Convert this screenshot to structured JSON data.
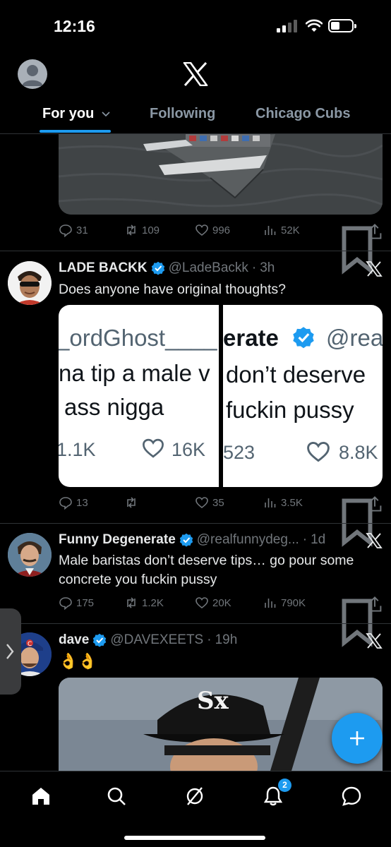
{
  "status_bar": {
    "time": "12:16"
  },
  "header": {
    "tabs": [
      {
        "label": "For you"
      },
      {
        "label": "Following"
      },
      {
        "label": "Chicago Cubs"
      }
    ]
  },
  "posts": [
    {
      "stats": {
        "replies": "31",
        "reposts": "109",
        "likes": "996",
        "views": "52K"
      }
    },
    {
      "name": "LADE BACKK",
      "handle": "@LadeBackk",
      "time": "3h",
      "text": "Does anyone have original thoughts?",
      "embed": {
        "left": {
          "handle_fragment": "_ordGhost____",
          "line1": "na tip a male v",
          "line2": "ass nigga",
          "reposts": "1.1K",
          "likes": "16K"
        },
        "right": {
          "name_fragment": "erate",
          "handle_fragment": "@rea",
          "line1": "don’t deserve",
          "line2": "fuckin pussy",
          "reposts": "523",
          "likes": "8.8K"
        }
      },
      "stats": {
        "replies": "13",
        "reposts": "",
        "likes": "35",
        "views": "3.5K"
      }
    },
    {
      "name": "Funny Degenerate",
      "handle": "@realfunnydeg...",
      "time": "1d",
      "text": "Male baristas don’t deserve tips… go pour some concrete you fuckin pussy",
      "stats": {
        "replies": "175",
        "reposts": "1.2K",
        "likes": "20K",
        "views": "790K"
      }
    },
    {
      "name": "dave",
      "handle": "@DAVEXEETS",
      "time": "19h",
      "text": "👌👌"
    }
  ],
  "nav": {
    "notifications_badge": "2"
  },
  "colors": {
    "accent": "#1d9bf0",
    "muted": "#71767b",
    "background": "#000000"
  }
}
